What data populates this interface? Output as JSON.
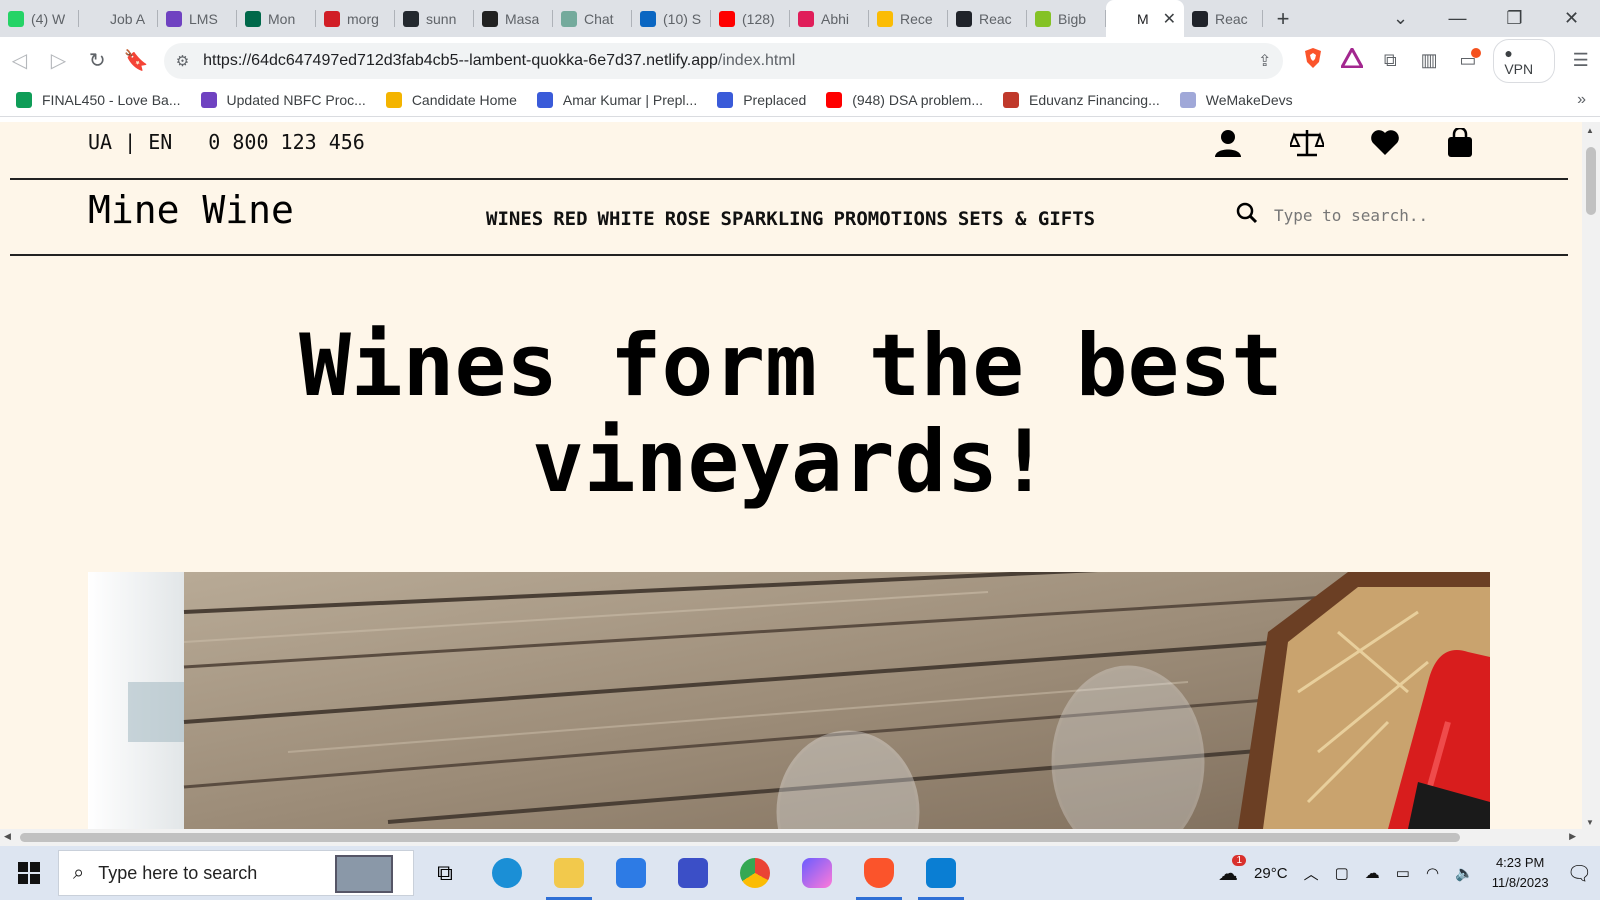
{
  "browser": {
    "tabs": [
      {
        "title": "(4) W",
        "color": "#25d366"
      },
      {
        "title": "Job A",
        "color": "#dee1e6"
      },
      {
        "title": "LMS",
        "color": "#6f42c1"
      },
      {
        "title": "Mon",
        "color": "#00684a"
      },
      {
        "title": "morg",
        "color": "#d11e26"
      },
      {
        "title": "sunn",
        "color": "#24292f"
      },
      {
        "title": "Masa",
        "color": "#222222"
      },
      {
        "title": "Chat",
        "color": "#74aa9c"
      },
      {
        "title": "(10) S",
        "color": "#0a66c2"
      },
      {
        "title": "(128)",
        "color": "#ff0000"
      },
      {
        "title": "Abhi",
        "color": "#e01e5a"
      },
      {
        "title": "Rece",
        "color": "#fbbc04"
      },
      {
        "title": "Reac",
        "color": "#20232a"
      },
      {
        "title": "Bigb",
        "color": "#84c225"
      },
      {
        "title": "M",
        "color": "#ffffff",
        "active": true
      },
      {
        "title": "Reac",
        "color": "#20232a"
      }
    ],
    "new_tab": "+",
    "url_host": "https://64dc647497ed712d3fab4cb5--lambent-quokka-6e7d37.netlify.app",
    "url_path": "/index.html",
    "vpn_label": "VPN",
    "bookmarks": [
      {
        "label": "FINAL450 - Love Ba...",
        "color": "#0f9d58"
      },
      {
        "label": "Updated NBFC Proc...",
        "color": "#6f42c1"
      },
      {
        "label": "Candidate Home",
        "color": "#f4b400"
      },
      {
        "label": "Amar Kumar | Prepl...",
        "color": "#3a5bd9"
      },
      {
        "label": "Preplaced",
        "color": "#3a5bd9"
      },
      {
        "label": "(948) DSA problem...",
        "color": "#ff0000"
      },
      {
        "label": "Eduvanz Financing...",
        "color": "#c0392b"
      },
      {
        "label": "WeMakeDevs",
        "color": "#a0a8d8"
      }
    ],
    "bookmarks_more": "»"
  },
  "site": {
    "lang": "UA | EN",
    "phone": "0 800 123 456",
    "brand": "Mine Wine",
    "nav": [
      "WINES",
      "RED",
      "WHITE",
      "ROSE",
      "SPARKLING",
      "PROMOTIONS",
      "SETS & GIFTS"
    ],
    "search_placeholder": "Type to search..",
    "hero_line1": "Wines form the best",
    "hero_line2": "vineyards!"
  },
  "taskbar": {
    "search_placeholder": "Type here to search",
    "weather_badge": "1",
    "temperature": "29°C",
    "time": "4:23 PM",
    "date": "11/8/2023"
  }
}
